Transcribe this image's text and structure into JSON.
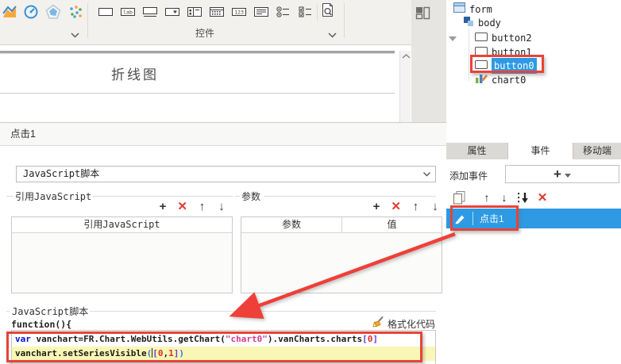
{
  "toolbar": {
    "widget_group_label": "控件",
    "chart_icons": [
      "area-chart-icon",
      "gauge-chart-icon",
      "radar-chart-icon",
      "scatter-chart-icon"
    ],
    "widget_icons": [
      "textfield-widget-icon",
      "label-widget-icon",
      "button-widget-icon",
      "combobox-widget-icon",
      "panel-widget-icon",
      "datepicker-widget-icon",
      "number-widget-icon",
      "textarea-widget-icon",
      "radiogroup-widget-icon",
      "checkboxgroup-widget-icon"
    ],
    "label_icon_glyph": "lab",
    "number_icon_glyph": "123",
    "preview_icon": "preview-icon",
    "layout_icon": "layout-blocks-icon"
  },
  "tree": {
    "items": [
      {
        "label": "form"
      },
      {
        "label": "body"
      },
      {
        "label": "button2"
      },
      {
        "label": "button1"
      },
      {
        "label": "button0",
        "selected": true
      },
      {
        "label": "chart0"
      }
    ]
  },
  "canvas": {
    "chart_title": "折线图"
  },
  "dialog": {
    "title": "点击1",
    "event_type_value": "JavaScript脚本",
    "ref_js": {
      "legend": "引用JavaScript",
      "table_header": "引用JavaScript"
    },
    "params": {
      "legend": "参数",
      "col_param": "参数",
      "col_value": "值"
    },
    "script": {
      "legend": "JavaScript脚本",
      "function_line": "function(){",
      "format_button": "格式化代码",
      "line1": [
        {
          "t": "var",
          "c": "kw"
        },
        {
          "t": " vanchart=FR.Chart.WebUtils.getChart(",
          "c": "plain"
        },
        {
          "t": "\"chart0\"",
          "c": "str"
        },
        {
          "t": ").vanCharts.charts",
          "c": "plain"
        },
        {
          "t": "[",
          "c": "br"
        },
        {
          "t": "0",
          "c": "num"
        },
        {
          "t": "]",
          "c": "br"
        }
      ],
      "line2": [
        {
          "t": "vanchart.setSeriesVisible",
          "c": "plain"
        },
        {
          "t": "(",
          "c": "paren"
        },
        {
          "t": "[",
          "c": "br"
        },
        {
          "t": "0",
          "c": "num"
        },
        {
          "t": ",",
          "c": "plain"
        },
        {
          "t": "1",
          "c": "num"
        },
        {
          "t": "]",
          "c": "br"
        },
        {
          "t": ")",
          "c": "paren"
        }
      ]
    }
  },
  "right_panel": {
    "tabs": [
      {
        "label": "属性",
        "active": false
      },
      {
        "label": "事件",
        "active": true
      },
      {
        "label": "移动端",
        "active": false
      }
    ],
    "add_event_label": "添加事件",
    "event_item_label": "点击1"
  },
  "icons": {
    "plus": "+",
    "close": "✕",
    "up": "↑",
    "down": "↓"
  },
  "colors": {
    "selection_blue": "#2d9ae3",
    "annotation_red": "#e84338",
    "current_line_yellow": "#faf7b6",
    "code_keyword": "#0010d8",
    "code_string": "#d23a8c",
    "code_number": "#e03122",
    "toolbar_bg": "#f3f1ed"
  }
}
